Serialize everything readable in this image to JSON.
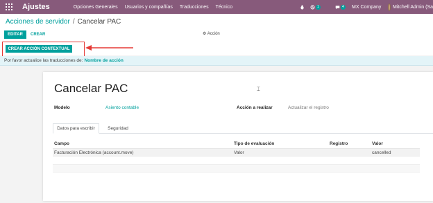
{
  "navbar": {
    "app_title": "Ajustes",
    "menu": [
      "Opciones Generales",
      "Usuarios y compañías",
      "Traducciones",
      "Técnico"
    ],
    "activity_count": "1",
    "messages_count": "4",
    "company": "MX Company",
    "user": "Mitchell Admin (Sa"
  },
  "breadcrumb": {
    "parent": "Acciones de servidor",
    "separator": "/",
    "current": "Cancelar PAC"
  },
  "toolbar": {
    "edit_label": "EDITAR",
    "create_label": "CREAR",
    "action_label": "Acción",
    "contextual_label": "CREAR ACCIÓN CONTEXTUAL"
  },
  "infobar": {
    "text": "Por favor actualice las traducciones de:",
    "field": "Nombre de acción"
  },
  "form": {
    "title": "Cancelar PAC",
    "model_label": "Modelo",
    "model_value": "Asiento contable",
    "action_label": "Acción a realizar",
    "action_value": "Actualizar el registro"
  },
  "tabs": [
    "Datos para escribir",
    "Seguridad"
  ],
  "table": {
    "columns": [
      "Campo",
      "Tipo de evaluación",
      "Registro",
      "Valor"
    ],
    "rows": [
      [
        "Facturación Electrónica (account.move)",
        "Valor",
        "",
        "cancelled"
      ]
    ]
  },
  "colors": {
    "navbar": "#875a7b",
    "accent": "#00a09d",
    "highlight": "#e53935"
  },
  "icons": [
    "apps-grid-icon",
    "activity-icon",
    "chat-icon",
    "user-avatar",
    "gear-icon",
    "mouse-cursor-icon",
    "annotation-arrow"
  ]
}
